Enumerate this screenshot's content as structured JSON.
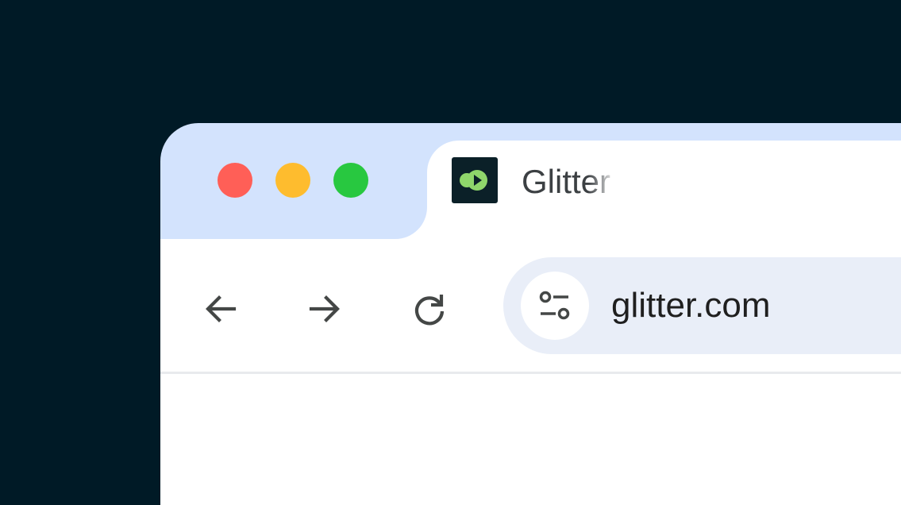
{
  "window": {
    "controls": [
      "close",
      "minimize",
      "zoom"
    ],
    "colors": {
      "background": "#001a26",
      "frame": "#d3e3fd",
      "close": "#ff5f57",
      "minimize": "#febc2e",
      "zoom": "#28c840",
      "omnibox": "#e9eef8"
    }
  },
  "tab": {
    "title": "Glitter",
    "favicon": "glitter-logo-icon",
    "favicon_colors": {
      "bg": "#0b2028",
      "mark": "#8fd66b"
    }
  },
  "toolbar": {
    "back_icon": "arrow-left-icon",
    "forward_icon": "arrow-right-icon",
    "reload_icon": "reload-icon"
  },
  "omnibox": {
    "url": "glitter.com",
    "site_info_icon": "tune-icon"
  }
}
